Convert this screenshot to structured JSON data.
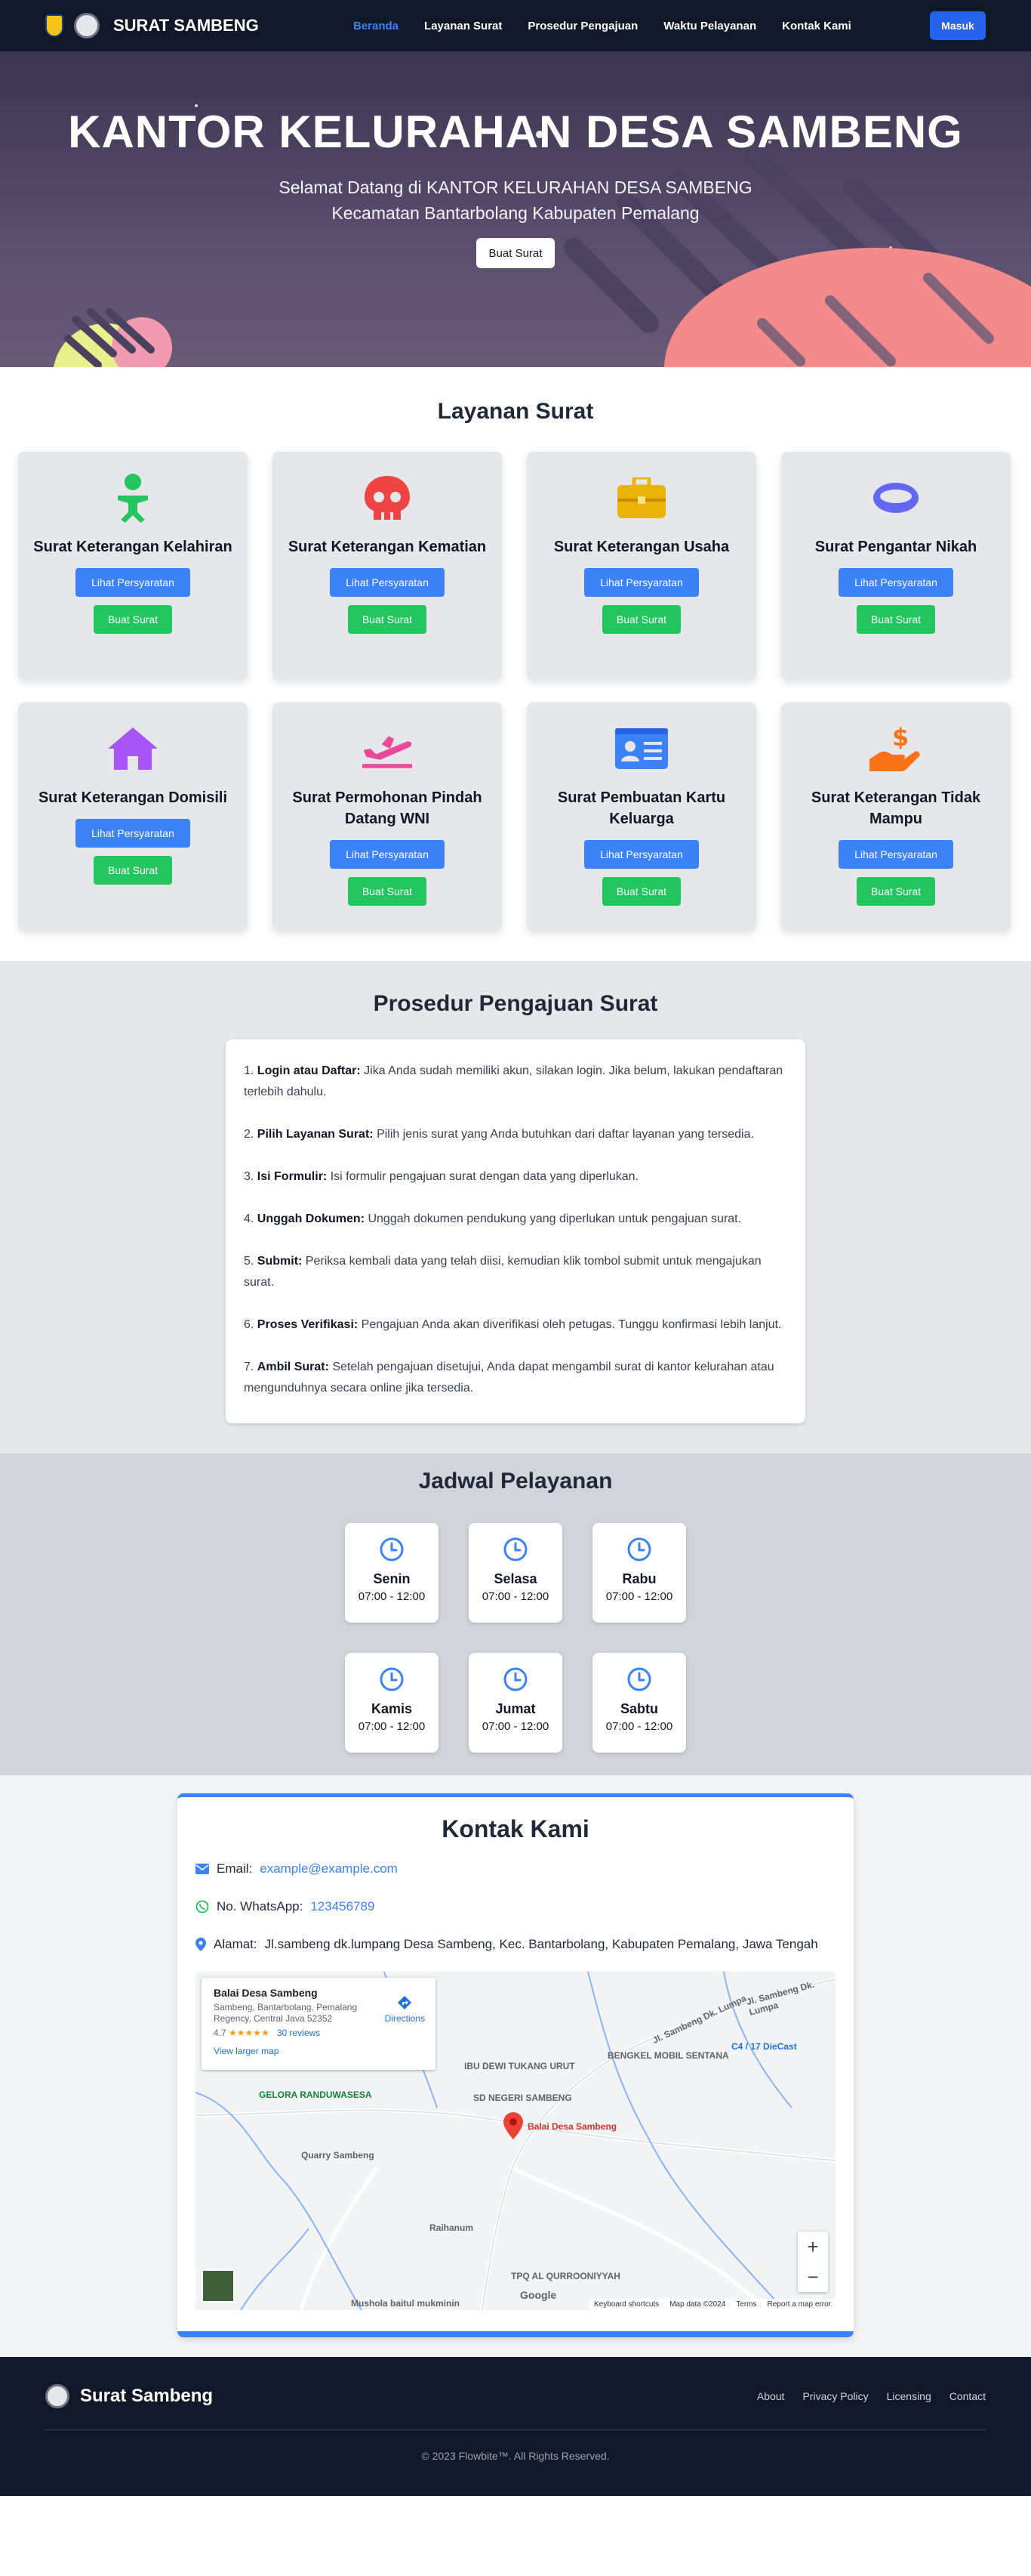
{
  "nav": {
    "brand": "SURAT SAMBENG",
    "menu": [
      {
        "label": "Beranda"
      },
      {
        "label": "Layanan Surat"
      },
      {
        "label": "Prosedur Pengajuan"
      },
      {
        "label": "Waktu Pelayanan"
      },
      {
        "label": "Kontak Kami"
      }
    ],
    "login": "Masuk"
  },
  "hero": {
    "title": "KANTOR KELURAHAN DESA SAMBENG",
    "line1": "Selamat Datang di KANTOR KELURAHAN DESA SAMBENG",
    "line2": "Kecamatan Bantarbolang Kabupaten Pemalang",
    "button": "Buat Surat"
  },
  "services": {
    "title": "Layanan Surat",
    "btn_requirements": "Lihat Persyaratan",
    "btn_create": "Buat Surat",
    "items": [
      {
        "title": "Surat Keterangan Kelahiran",
        "icon": "baby-icon",
        "color": "#22c55e"
      },
      {
        "title": "Surat Keterangan Kematian",
        "icon": "skull-icon",
        "color": "#ef4444"
      },
      {
        "title": "Surat Keterangan Usaha",
        "icon": "briefcase-icon",
        "color": "#eab308"
      },
      {
        "title": "Surat Pengantar Nikah",
        "icon": "ring-icon",
        "color": "#6366f1"
      },
      {
        "title": "Surat Keterangan Domisili",
        "icon": "home-icon",
        "color": "#a855f7"
      },
      {
        "title": "Surat Permohonan Pindah Datang WNI",
        "icon": "plane-departure-icon",
        "color": "#ec4899"
      },
      {
        "title": "Surat Pembuatan Kartu Keluarga",
        "icon": "id-card-icon",
        "color": "#3b82f6"
      },
      {
        "title": "Surat Keterangan Tidak Mampu",
        "icon": "hand-holding-dollar-icon",
        "color": "#f97316"
      }
    ]
  },
  "procedure": {
    "title": "Prosedur Pengajuan Surat",
    "steps": [
      {
        "num": "1.",
        "head": "Login atau Daftar:",
        "text": "Jika Anda sudah memiliki akun, silakan login. Jika belum, lakukan pendaftaran terlebih dahulu."
      },
      {
        "num": "2.",
        "head": "Pilih Layanan Surat:",
        "text": "Pilih jenis surat yang Anda butuhkan dari daftar layanan yang tersedia."
      },
      {
        "num": "3.",
        "head": "Isi Formulir:",
        "text": "Isi formulir pengajuan surat dengan data yang diperlukan."
      },
      {
        "num": "4.",
        "head": "Unggah Dokumen:",
        "text": "Unggah dokumen pendukung yang diperlukan untuk pengajuan surat."
      },
      {
        "num": "5.",
        "head": "Submit:",
        "text": "Periksa kembali data yang telah diisi, kemudian klik tombol submit untuk mengajukan surat."
      },
      {
        "num": "6.",
        "head": "Proses Verifikasi:",
        "text": "Pengajuan Anda akan diverifikasi oleh petugas. Tunggu konfirmasi lebih lanjut."
      },
      {
        "num": "7.",
        "head": "Ambil Surat:",
        "text": "Setelah pengajuan disetujui, Anda dapat mengambil surat di kantor kelurahan atau mengunduhnya secara online jika tersedia."
      }
    ]
  },
  "schedule": {
    "title": "Jadwal Pelayanan",
    "days": [
      {
        "name": "Senin",
        "time": "07:00 - 12:00"
      },
      {
        "name": "Selasa",
        "time": "07:00 - 12:00"
      },
      {
        "name": "Rabu",
        "time": "07:00 - 12:00"
      },
      {
        "name": "Kamis",
        "time": "07:00 - 12:00"
      },
      {
        "name": "Jumat",
        "time": "07:00 - 12:00"
      },
      {
        "name": "Sabtu",
        "time": "07:00 - 12:00"
      }
    ]
  },
  "contact": {
    "title": "Kontak Kami",
    "email_label": "Email:",
    "email": "example@example.com",
    "wa_label": "No. WhatsApp:",
    "wa": "123456789",
    "address_label": "Alamat:",
    "address": "Jl.sambeng dk.lumpang Desa Sambeng, Kec. Bantarbolang, Kabupaten Pemalang, Jawa Tengah"
  },
  "map": {
    "place": "Balai Desa Sambeng",
    "address": "Sambeng, Bantarbolang, Pemalang Regency, Central Java 52352",
    "rating": "4.7",
    "stars": "★★★★★",
    "reviews": "30 reviews",
    "directions": "Directions",
    "larger": "View larger map",
    "pin_label": "Balai Desa Sambeng",
    "labels": {
      "ibu_dewi": "IBU DEWI TUKANG URUT",
      "bengkel": "BENGKEL MOBIL SENTANA",
      "c4": "C4 / 17 DieCast",
      "gelora": "GELORA RANDUWASESA",
      "sdn": "SD NEGERI SAMBENG",
      "quarry": "Quarry Sambeng",
      "raihanum": "Raihanum",
      "tpq": "TPQ AL QURROONIYYAH",
      "mushola": "Mushola baitul mukminin",
      "road": "Jl. Sambeng Dk. Lumpa",
      "road2": "Jl. Sambeng Dk. Lumpa",
      "google": "Google"
    },
    "footer": [
      "Keyboard shortcuts",
      "Map data ©2024",
      "Terms",
      "Report a map error"
    ],
    "zoom_in": "+",
    "zoom_out": "−"
  },
  "footer": {
    "brand": "Surat Sambeng",
    "links": [
      {
        "label": "About"
      },
      {
        "label": "Privacy Policy"
      },
      {
        "label": "Licensing"
      },
      {
        "label": "Contact"
      }
    ],
    "copyright": "© 2023 Flowbite™. All Rights Reserved."
  }
}
